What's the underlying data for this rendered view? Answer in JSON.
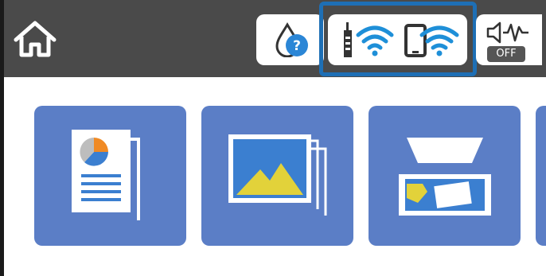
{
  "header": {
    "quiet_mode_status": "OFF",
    "icons": [
      "home-icon",
      "ink-drop-icon",
      "help-icon",
      "wifi-router-icon",
      "wifi-direct-icon",
      "quiet-mode-icon"
    ]
  },
  "tiles": [
    {
      "icon": "copy-icon"
    },
    {
      "icon": "photo-print-icon"
    },
    {
      "icon": "scan-icon"
    }
  ],
  "colors": {
    "topbar": "#4a4a4a",
    "tile": "#5b7ec6",
    "highlight": "#1e6fb5",
    "wifi": "#1e8fd8"
  }
}
